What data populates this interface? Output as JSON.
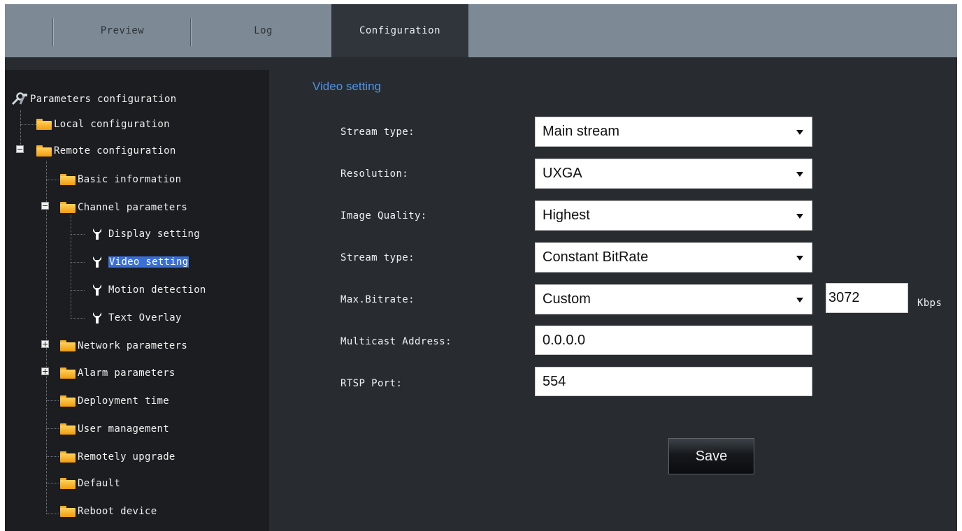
{
  "tabs": [
    {
      "label": "Preview"
    },
    {
      "label": "Log"
    },
    {
      "label": "Configuration",
      "active": true
    }
  ],
  "tree": {
    "root": "Parameters configuration",
    "local": "Local configuration",
    "remote": "Remote configuration",
    "basic": "Basic information",
    "channel": "Channel parameters",
    "display": "Display setting",
    "video": "Video setting",
    "motion": "Motion detection",
    "overlay": "Text Overlay",
    "network": "Network parameters",
    "alarm": "Alarm parameters",
    "deployment": "Deployment time",
    "user": "User management",
    "upgrade": "Remotely upgrade",
    "default": "Default",
    "reboot": "Reboot device"
  },
  "form": {
    "title": "Video setting",
    "stream_type_label": "Stream type:",
    "stream_type_value": "Main stream",
    "resolution_label": "Resolution:",
    "resolution_value": "UXGA",
    "quality_label": "Image Quality:",
    "quality_value": "Highest",
    "bitrate_type_label": "Stream type:",
    "bitrate_type_value": "Constant BitRate",
    "max_bitrate_label": "Max.Bitrate:",
    "max_bitrate_value": "Custom",
    "custom_bitrate": "3072",
    "bitrate_unit": "Kbps",
    "multicast_label": "Multicast Address:",
    "multicast_value": "0.0.0.0",
    "rtsp_label": "RTSP Port:",
    "rtsp_value": "554",
    "save_label": "Save"
  },
  "colors": {
    "topbar": "#7d8994",
    "active_tab": "#2f353b",
    "panel": "#282c30",
    "sidebar": "#1b1d20",
    "accent_title": "#4f93e6",
    "selection": "#3a6fd6"
  }
}
